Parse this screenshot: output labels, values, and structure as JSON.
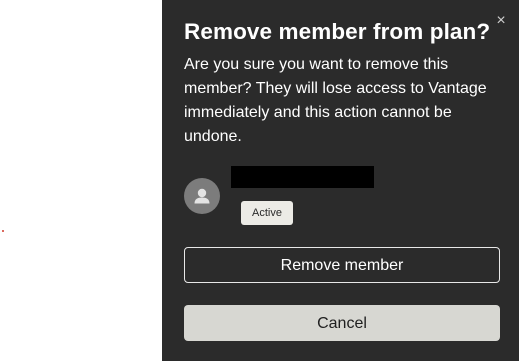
{
  "dialog": {
    "close_icon": "close-icon",
    "close_glyph": "×",
    "title": "Remove member from plan?",
    "description": "Are you sure you want to remove this member? They will lose access to Vantage immediately and this action cannot be undone.",
    "member": {
      "avatar_icon": "user-avatar-icon",
      "status_badge": "Active"
    },
    "remove_button_label": "Remove member",
    "cancel_button_label": "Cancel"
  },
  "colors": {
    "modal_background": "#2b2b2b",
    "cancel_button_background": "#d7d7d2",
    "badge_background": "#ecebe6",
    "avatar_background": "#7c7c7c"
  }
}
